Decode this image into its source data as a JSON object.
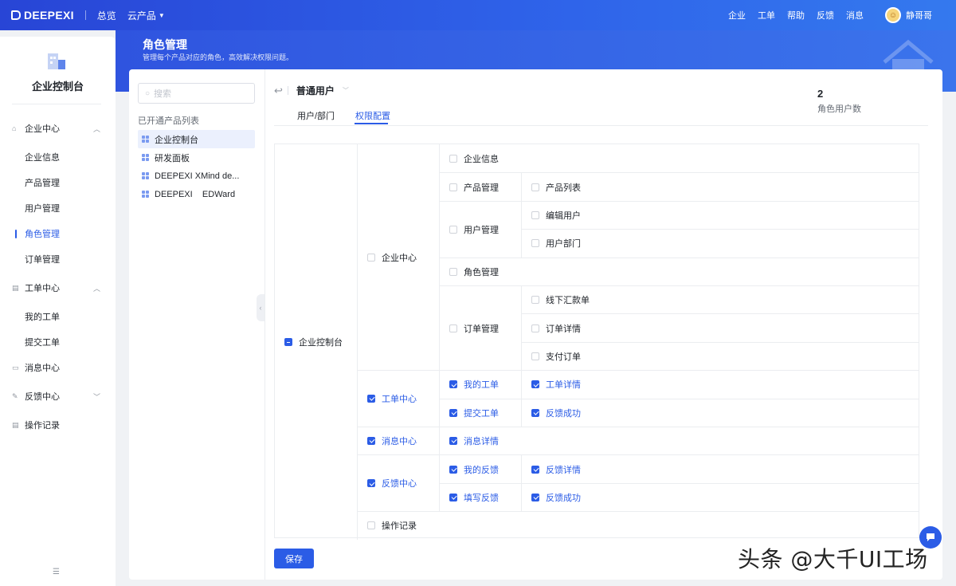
{
  "topbar": {
    "logo": "DEEPEXI",
    "nav": [
      "总览",
      "云产品"
    ],
    "right": [
      "企业",
      "工单",
      "帮助",
      "反馈",
      "消息"
    ],
    "user": "静哥哥"
  },
  "page": {
    "title": "角色管理",
    "subtitle": "管理每个产品对应的角色，高效解决权限问题。"
  },
  "sidebar": {
    "title": "企业控制台",
    "groups": [
      {
        "label": "企业中心",
        "icon": "home-icon",
        "expanded": true,
        "items": [
          "企业信息",
          "产品管理",
          "用户管理",
          "角色管理",
          "订单管理"
        ]
      },
      {
        "label": "工单中心",
        "icon": "ticket-icon",
        "expanded": true,
        "items": [
          "我的工单",
          "提交工单"
        ]
      },
      {
        "label": "消息中心",
        "icon": "message-icon"
      },
      {
        "label": "反馈中心",
        "icon": "feedback-icon",
        "expanded": false
      },
      {
        "label": "操作记录",
        "icon": "log-icon"
      }
    ],
    "active_item": "角色管理"
  },
  "products": {
    "search_placeholder": "搜索",
    "list_title": "已开通产品列表",
    "items": [
      "企业控制台",
      "研发面板",
      "DEEPEXI XMind de...",
      "DEEPEXI    EDWard"
    ],
    "selected": 0
  },
  "role": {
    "name": "普通用户",
    "tabs": [
      "用户/部门",
      "权限配置"
    ],
    "active_tab": 1,
    "user_count": "2",
    "user_count_label": "角色用户数"
  },
  "permissions": {
    "root": {
      "label": "企业控制台",
      "state": "indeterminate"
    },
    "rows": [
      {
        "l2": "企业中心",
        "l3": "企业信息"
      },
      {
        "l3": "产品管理",
        "l4": "产品列表"
      },
      {
        "l3": "用户管理",
        "l4": "编辑用户"
      },
      {
        "l4": "用户部门"
      },
      {
        "l3": "角色管理"
      },
      {
        "l3": "订单管理",
        "l4": "线下汇款单"
      },
      {
        "l4": "订单详情"
      },
      {
        "l4": "支付订单"
      },
      {
        "l2": "工单中心",
        "l3": "我的工单",
        "l4": "工单详情",
        "checked": true
      },
      {
        "l3": "提交工单",
        "l4": "反馈成功",
        "checked": true
      },
      {
        "l2": "消息中心",
        "l3": "消息详情",
        "checked": true
      },
      {
        "l2": "反馈中心",
        "l3": "我的反馈",
        "l4": "反馈详情",
        "checked": true
      },
      {
        "l3": "填写反馈",
        "l4": "反馈成功",
        "checked": true
      },
      {
        "l2": "操作记录"
      }
    ]
  },
  "actions": {
    "save": "保存"
  },
  "watermark": "头条 @大千UI工场"
}
